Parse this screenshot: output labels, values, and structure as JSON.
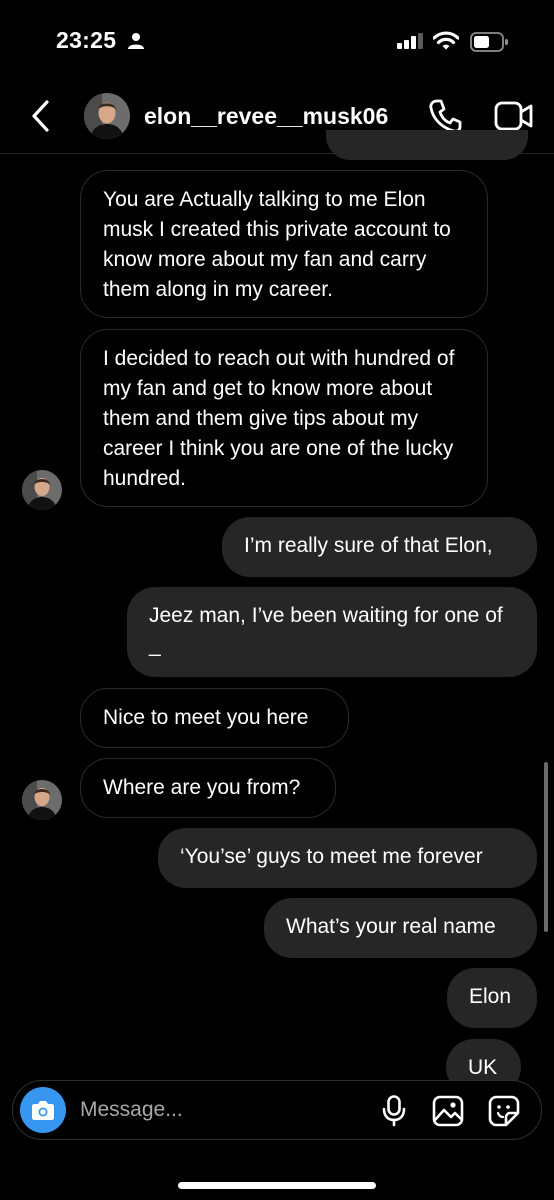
{
  "status_bar": {
    "time": "23:25"
  },
  "header": {
    "username": "elon__revee__musk06"
  },
  "messages": [
    {
      "sender": "them",
      "text": "You are Actually talking to me Elon musk I created this private account to know more about my fan and carry them along in my career."
    },
    {
      "sender": "them",
      "text": "I decided to reach out with hundred of my fan and get to know more about them and them give tips about my career I think you are one of the lucky hundred."
    },
    {
      "sender": "me",
      "text": "I’m really sure of that Elon,"
    },
    {
      "sender": "me",
      "text": "Jeez man, I’ve been waiting for one of _"
    },
    {
      "sender": "them",
      "text": "Nice to meet you here"
    },
    {
      "sender": "them",
      "text": "Where are you from?"
    },
    {
      "sender": "me",
      "text": "‘You’se’ guys to meet me forever"
    },
    {
      "sender": "me",
      "text": "What’s your real name"
    },
    {
      "sender": "me",
      "text": "Elon"
    },
    {
      "sender": "me",
      "text": "UK"
    }
  ],
  "composer": {
    "placeholder": "Message..."
  },
  "colors": {
    "background": "#000000",
    "outgoing_bubble": "#262626",
    "camera_button": "#3797f0",
    "placeholder": "#a8a8a8"
  }
}
